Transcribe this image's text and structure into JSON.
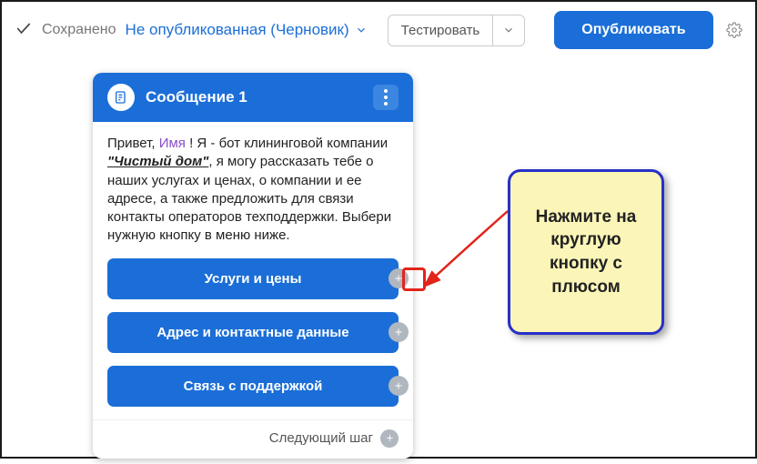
{
  "topbar": {
    "saved": "Сохранено",
    "draft": "Не опубликованная (Черновик)",
    "test": "Тестировать",
    "publish": "Опубликовать"
  },
  "card": {
    "title": "Сообщение 1",
    "msg_prefix": "Привет, ",
    "msg_name": "Имя",
    "msg_mid1": " ! Я - бот клининговой компании ",
    "msg_company": "\"Чистый дом\"",
    "msg_rest": ", я могу рассказать тебе о наших услугах и ценах, о компании и ее адресе, а также предложить для связи контакты операторов техподдержки. Выбери нужную кнопку в меню ниже.",
    "options": {
      "0": "Услуги и цены",
      "1": "Адрес и контактные данные",
      "2": "Связь с поддержкой"
    },
    "next_step": "Следующий шаг"
  },
  "callout": {
    "text": "Нажмите на круглую кнопку с плюсом"
  }
}
